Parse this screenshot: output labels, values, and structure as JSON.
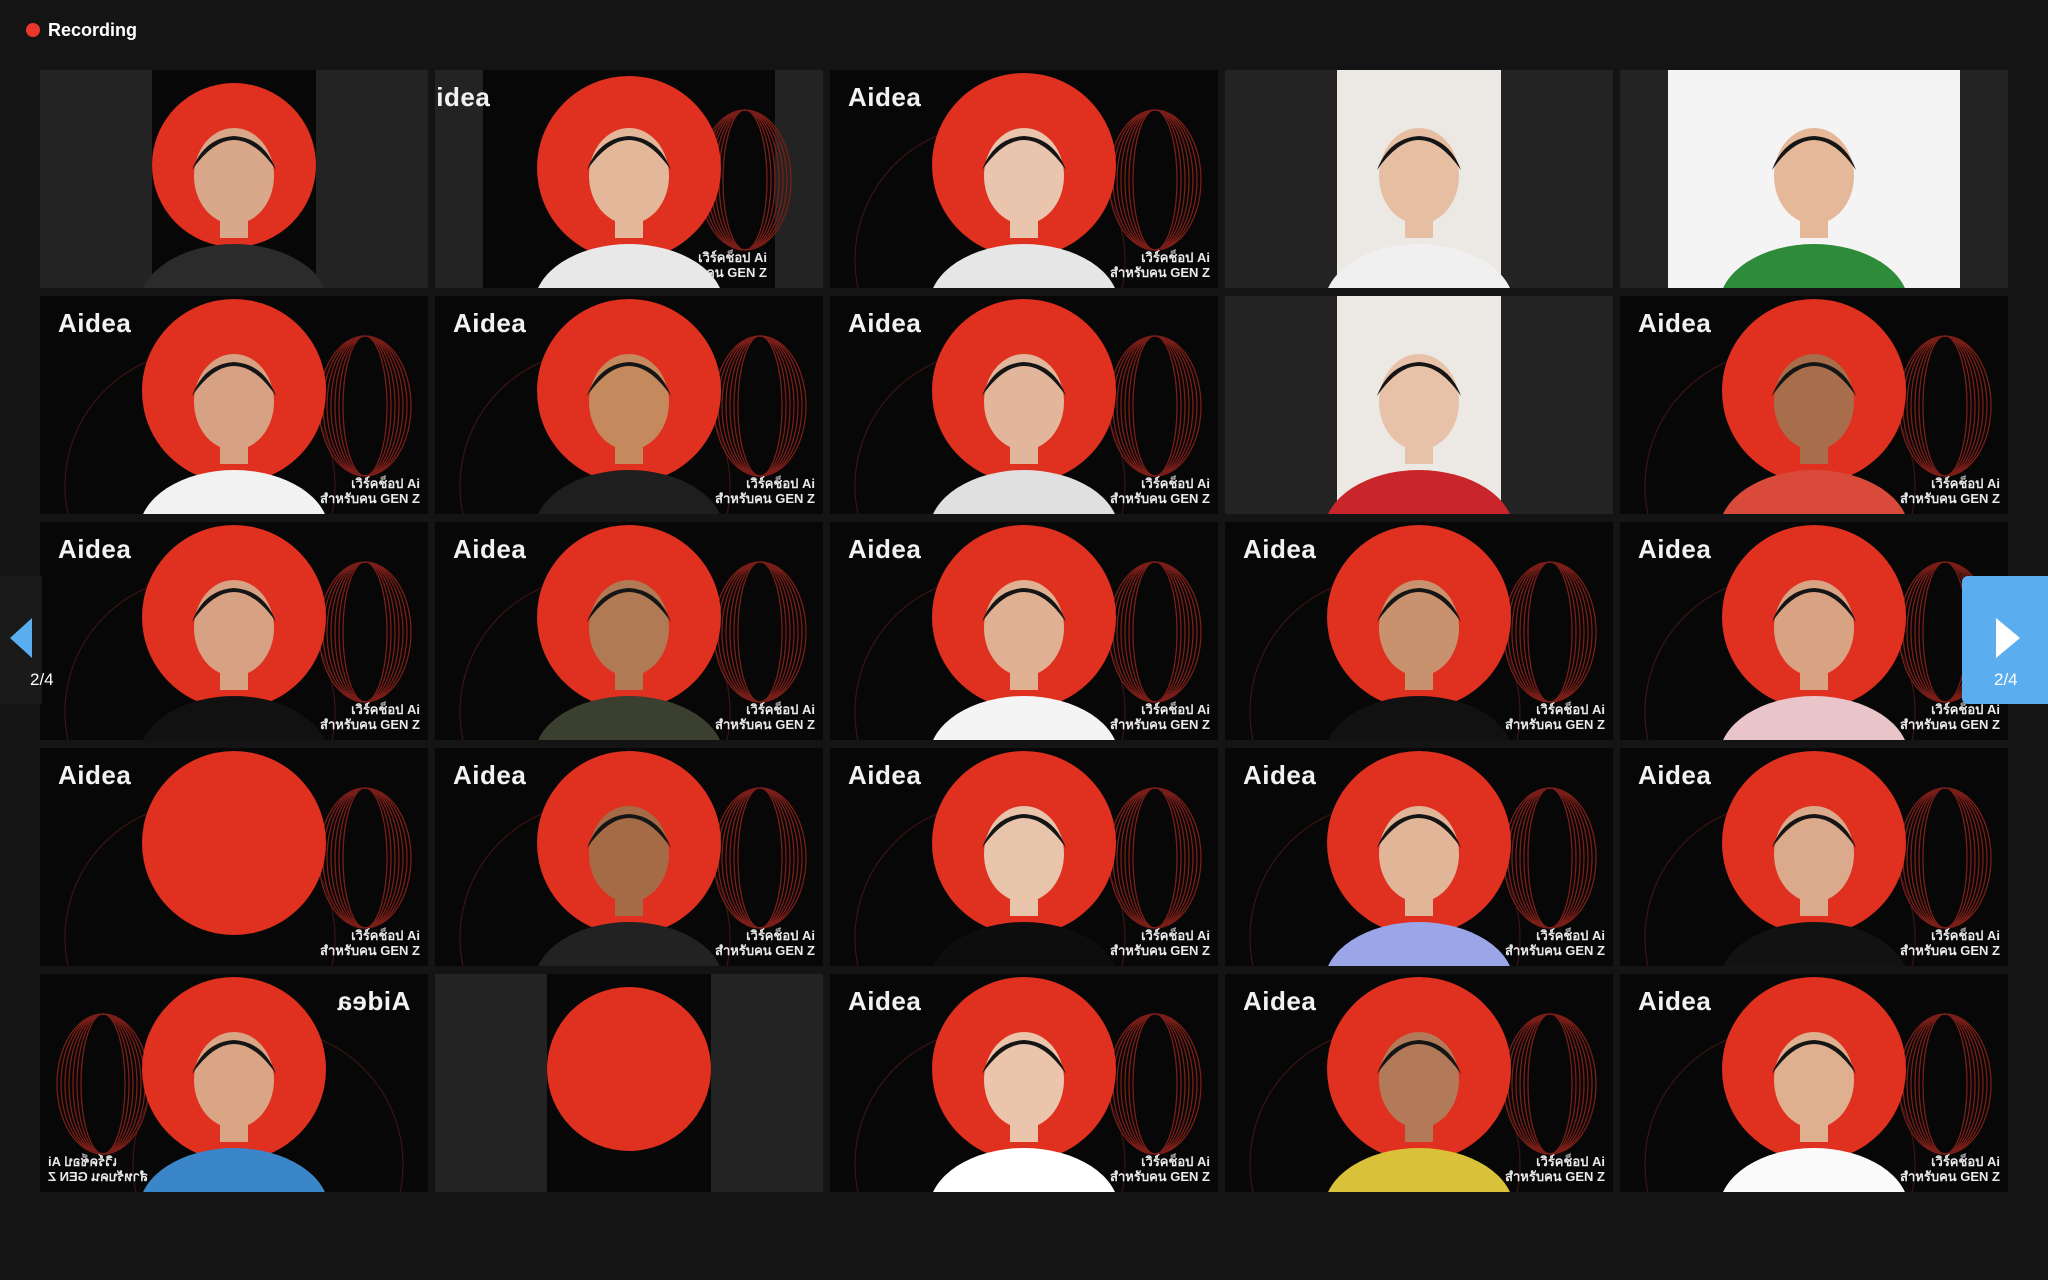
{
  "recording": {
    "label": "Recording",
    "dot_color": "#e8372b"
  },
  "brand_text": "Aidea",
  "caption_line1": "เวิร์คช็อป Ai",
  "caption_line2": "สำหรับคน GEN Z",
  "pager": {
    "prev_label": "2/4",
    "next_label": "2/4",
    "accent": "#5aaef0"
  },
  "participants": [
    {
      "kind": "aidea-narrow"
    },
    {
      "kind": "aidea-crop"
    },
    {
      "kind": "aidea"
    },
    {
      "kind": "camera-narrow"
    },
    {
      "kind": "camera-wide"
    },
    {
      "kind": "aidea"
    },
    {
      "kind": "aidea"
    },
    {
      "kind": "aidea"
    },
    {
      "kind": "camera-narrow"
    },
    {
      "kind": "aidea"
    },
    {
      "kind": "aidea"
    },
    {
      "kind": "aidea"
    },
    {
      "kind": "aidea"
    },
    {
      "kind": "aidea"
    },
    {
      "kind": "aidea"
    },
    {
      "kind": "aidea-empty"
    },
    {
      "kind": "aidea"
    },
    {
      "kind": "aidea"
    },
    {
      "kind": "aidea"
    },
    {
      "kind": "aidea"
    },
    {
      "kind": "aidea-mirror"
    },
    {
      "kind": "aidea-empty-narrow"
    },
    {
      "kind": "aidea"
    },
    {
      "kind": "aidea"
    },
    {
      "kind": "aidea"
    }
  ]
}
